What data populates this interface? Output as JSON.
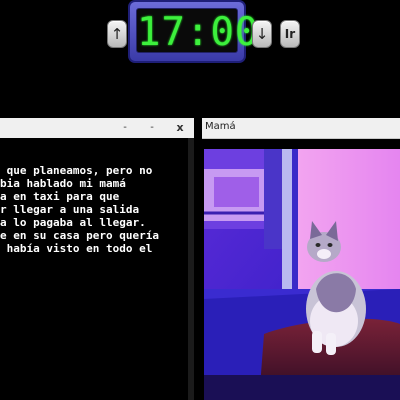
{
  "clock": {
    "time": "17:00",
    "up_button": "↑",
    "down_button": "↓",
    "go_button": "Ir"
  },
  "text_window": {
    "minimize_icon": "-",
    "maximize_icon": "-",
    "close_icon": "x",
    "lines": [
      " que planeamos, pero no",
      "bia hablado mi mamá",
      "a en taxi para que",
      "r llegar a una salida",
      "a lo pagaba al llegar.",
      "e en su casa pero quería",
      " había visto en todo el"
    ]
  },
  "photo_window": {
    "title": "Mamá",
    "photo_subject": "cat sitting on a couch next to a window"
  },
  "colors": {
    "digit_green": "#3df03d",
    "clock_frame": "#4b4bc0",
    "background": "#000000",
    "titlebar": "#f0f0f0"
  }
}
